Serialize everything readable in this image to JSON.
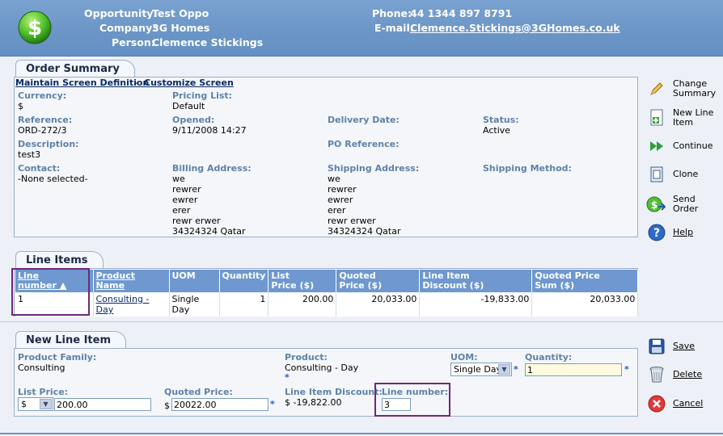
{
  "header": {
    "opportunity_label": "Opportunity:",
    "opportunity_value": "Test Oppo",
    "company_label": "Company:",
    "company_value": "3G Homes",
    "person_label": "Person:",
    "person_value": "Clemence Stickings",
    "phone_label": "Phone:",
    "phone_value": "44 1344 897 8791",
    "email_label": "E-mail:",
    "email_value": "Clemence.Stickings@3GHomes.co.uk"
  },
  "order_summary": {
    "tab_title": "Order Summary",
    "maintain_link": "Maintain Screen Definition",
    "separator": " - ",
    "customize_link": "Customize Screen",
    "currency_label": "Currency:",
    "currency_value": "$",
    "pricing_list_label": "Pricing List:",
    "pricing_list_value": "Default",
    "reference_label": "Reference:",
    "reference_value": "ORD-272/3",
    "opened_label": "Opened:",
    "opened_value": "9/11/2008 14:27",
    "delivery_label": "Delivery Date:",
    "status_label": "Status:",
    "status_value": "Active",
    "description_label": "Description:",
    "description_value": "test3",
    "po_label": "PO Reference:",
    "contact_label": "Contact:",
    "contact_value": "-None selected-",
    "billing_label": "Billing Address:",
    "billing_lines": [
      "we",
      "rewrer",
      "ewrer",
      "erer",
      "rewr erwer",
      "34324324 Qatar"
    ],
    "shipping_label": "Shipping Address:",
    "shipping_lines": [
      "we",
      "rewrer",
      "ewrer",
      "erer",
      "rewr erwer",
      "34324324 Qatar"
    ],
    "shipping_method_label": "Shipping Method:"
  },
  "line_items": {
    "tab_title": "Line Items",
    "columns": [
      {
        "l1": "Line",
        "l2": "number ▲"
      },
      {
        "l1": "Product",
        "l2": "Name"
      },
      {
        "l1": "UOM",
        "l2": ""
      },
      {
        "l1": "Quantity",
        "l2": ""
      },
      {
        "l1": "List",
        "l2": "Price ($)"
      },
      {
        "l1": "Quoted",
        "l2": "Price ($)"
      },
      {
        "l1": "Line Item",
        "l2": "Discount ($)"
      },
      {
        "l1": "Quoted Price",
        "l2": "Sum ($)"
      }
    ],
    "rows": [
      {
        "line_number": "1",
        "product_l1": "Consulting -",
        "product_l2": "Day",
        "uom_l1": "Single",
        "uom_l2": "Day",
        "quantity": "1",
        "list_price": "200.00",
        "quoted_price": "20,033.00",
        "discount": "-19,833.00",
        "sum": "20,033.00"
      }
    ]
  },
  "new_line_item": {
    "tab_title": "New Line Item",
    "product_family_label": "Product Family:",
    "product_family_value": "Consulting",
    "product_label": "Product:",
    "product_value": "Consulting - Day",
    "uom_label": "UOM:",
    "uom_value": "Single Day",
    "quantity_label": "Quantity:",
    "quantity_value": "1",
    "list_price_label": "List Price:",
    "list_price_currency": "$",
    "list_price_value": "200.00",
    "quoted_price_label": "Quoted Price:",
    "quoted_price_currency": "$",
    "quoted_price_value": "20022.00",
    "discount_label": "Line Item Discount:",
    "discount_value": "$ -19,822.00",
    "line_number_label": "Line number:",
    "line_number_value": "3",
    "required_mark": "*"
  },
  "actions_top": [
    {
      "l1": "Change",
      "l2": "Summary"
    },
    {
      "l1": "New Line",
      "l2": "Item"
    },
    {
      "l1": "Continue",
      "l2": ""
    },
    {
      "l1": "Clone",
      "l2": ""
    },
    {
      "l1": "Send Order",
      "l2": ""
    },
    {
      "l1": "Help",
      "l2": ""
    }
  ],
  "actions_bottom": [
    {
      "label": "Save"
    },
    {
      "label": "Delete"
    },
    {
      "label": "Cancel"
    }
  ],
  "colors": {
    "header_bg": "#6b95c6",
    "table_header_bg": "#6e98cf",
    "label_color": "#5f82a8",
    "highlight_border": "#6b2a7a"
  }
}
